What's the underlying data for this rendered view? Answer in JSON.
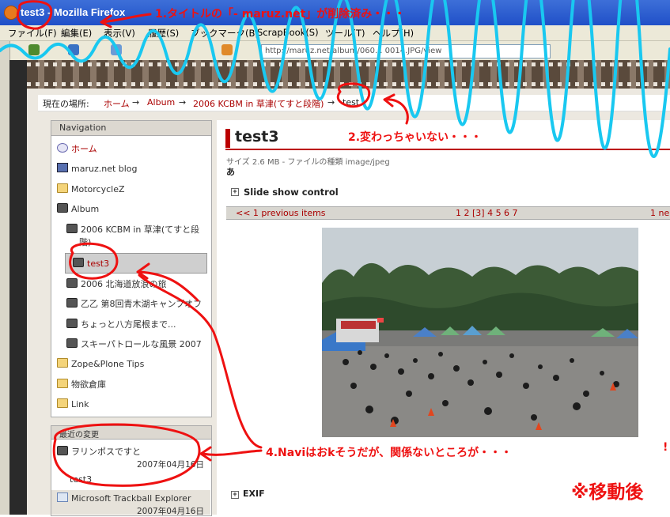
{
  "window": {
    "title": "test3 - Mozilla Firefox"
  },
  "menubar": [
    "ファイル(F)",
    "編集(E)",
    "表示(V)",
    "履歴(S)",
    "ブックマーク(B)",
    "ScrapBook(S)",
    "ツール(T)",
    "ヘルプ(H)"
  ],
  "toolbar": {
    "url_partial": "http://maruz.net/album/060... 0014.JPG/view"
  },
  "breadcrumb": {
    "prefix": "現在の場所:",
    "items": [
      "ホーム",
      "Album",
      "2006 KCBM in 草津(てすと段階)",
      "test"
    ],
    "sep": "→"
  },
  "navigation": {
    "title": "Navigation",
    "items": [
      {
        "label": "ホーム",
        "icon": "home-icon"
      },
      {
        "label": "maruz.net blog",
        "icon": "blog-icon"
      },
      {
        "label": "MotorcycleZ",
        "icon": "folder-icon"
      },
      {
        "label": "Album",
        "icon": "camera-folder-icon"
      },
      {
        "label": "2006 KCBM in 草津(てすと段",
        "label2": "階)",
        "icon": "camera-folder-icon"
      },
      {
        "label": "test3",
        "icon": "camera-folder-icon",
        "selected": true
      },
      {
        "label": "2006 北海道放浪の旅",
        "icon": "camera-folder-icon"
      },
      {
        "label": "乙乙 第8回青木湖キャンプオフ",
        "icon": "camera-folder-icon"
      },
      {
        "label": "ちょっと八方尾根まで...",
        "icon": "camera-folder-icon"
      },
      {
        "label": "スキーパトロールな風景 2007",
        "icon": "camera-folder-icon"
      },
      {
        "label": "Zope&Plone Tips",
        "icon": "folder-icon"
      },
      {
        "label": "物欲倉庫",
        "icon": "folder-icon"
      },
      {
        "label": "Link",
        "icon": "folder-icon"
      }
    ]
  },
  "recent": {
    "title": "最近の変更",
    "items": [
      {
        "label": "ヲリンポスですと",
        "date": "2007年04月16日",
        "icon": "camera-folder-icon"
      },
      {
        "label": "test3",
        "date": "2007年04月16日"
      },
      {
        "label": "Microsoft Trackball Explorer",
        "date": "2007年04月16日",
        "icon": "document-icon"
      }
    ]
  },
  "content": {
    "title": "test3",
    "meta": "サイズ 2.6 MB - ファイルの種類 image/jpeg",
    "description": "あ",
    "slideshow_label": "Slide show control",
    "pager": {
      "prev": "<< 1 previous items",
      "pages": "1 2 [3] 4 5 6 7",
      "next": "1 ne"
    },
    "exif_label": "EXIF",
    "toggle_symbol": "+"
  },
  "annotations": {
    "note1": "1.タイトルの「- maruz.net」が削除済み・・・",
    "note2": "2.変わっちゃいない・・・",
    "note4": "4.Naviはおkそうだが、関係ないところが・・・",
    "note_moved": "※移動後",
    "stray": "!"
  },
  "colors": {
    "annotation": "#ee1111",
    "accent": "#b00000",
    "titlebar": "#2f5fd0"
  }
}
